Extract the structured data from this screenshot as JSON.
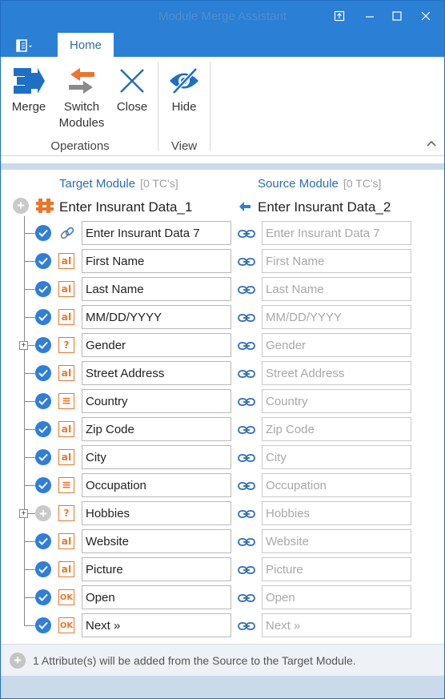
{
  "window": {
    "title": "Module Merge Assistant"
  },
  "ribbon": {
    "tab": "Home",
    "buttons": {
      "merge": "Merge",
      "switch_line1": "Switch",
      "switch_line2": "Modules",
      "close": "Close",
      "hide": "Hide"
    },
    "groups": {
      "operations": "Operations",
      "view": "View"
    }
  },
  "target": {
    "header": "Target Module",
    "tc": "[0 TC's]",
    "name": "Enter Insurant Data_1"
  },
  "source": {
    "header": "Source Module",
    "tc": "[0 TC's]",
    "name": "Enter Insurant Data_2"
  },
  "rows": [
    {
      "target": "Enter Insurant Data 7",
      "source": "Enter Insurant Data 7",
      "icon": "link-icon",
      "state": "checked",
      "expandable": false
    },
    {
      "target": "First Name",
      "source": "First Name",
      "icon": "textbox-icon",
      "state": "checked",
      "expandable": false
    },
    {
      "target": "Last Name",
      "source": "Last Name",
      "icon": "textbox-icon",
      "state": "checked",
      "expandable": false
    },
    {
      "target": "MM/DD/YYYY",
      "source": "MM/DD/YYYY",
      "icon": "textbox-icon",
      "state": "checked",
      "expandable": false
    },
    {
      "target": "Gender",
      "source": "Gender",
      "icon": "question-icon",
      "state": "checked",
      "expandable": true
    },
    {
      "target": "Street Address",
      "source": "Street Address",
      "icon": "textbox-icon",
      "state": "checked",
      "expandable": false
    },
    {
      "target": "Country",
      "source": "Country",
      "icon": "combobox-icon",
      "state": "checked",
      "expandable": false
    },
    {
      "target": "Zip Code",
      "source": "Zip Code",
      "icon": "textbox-icon",
      "state": "checked",
      "expandable": false
    },
    {
      "target": "City",
      "source": "City",
      "icon": "textbox-icon",
      "state": "checked",
      "expandable": false
    },
    {
      "target": "Occupation",
      "source": "Occupation",
      "icon": "combobox-icon",
      "state": "checked",
      "expandable": false
    },
    {
      "target": "Hobbies",
      "source": "Hobbies",
      "icon": "question-icon",
      "state": "add",
      "expandable": true
    },
    {
      "target": "Website",
      "source": "Website",
      "icon": "textbox-icon",
      "state": "checked",
      "expandable": false
    },
    {
      "target": "Picture",
      "source": "Picture",
      "icon": "textbox-icon",
      "state": "checked",
      "expandable": false
    },
    {
      "target": "Open",
      "source": "Open",
      "icon": "ok-button-icon",
      "state": "checked",
      "expandable": false
    },
    {
      "target": "Next »",
      "source": "Next »",
      "icon": "ok-button-icon",
      "state": "checked",
      "expandable": false
    }
  ],
  "status": {
    "text": "1 Attribute(s) will be added from the Source to the Target Module."
  },
  "colors": {
    "accent": "#2b7fd4",
    "check": "#2f7ed8",
    "orange": "#e9762b"
  }
}
